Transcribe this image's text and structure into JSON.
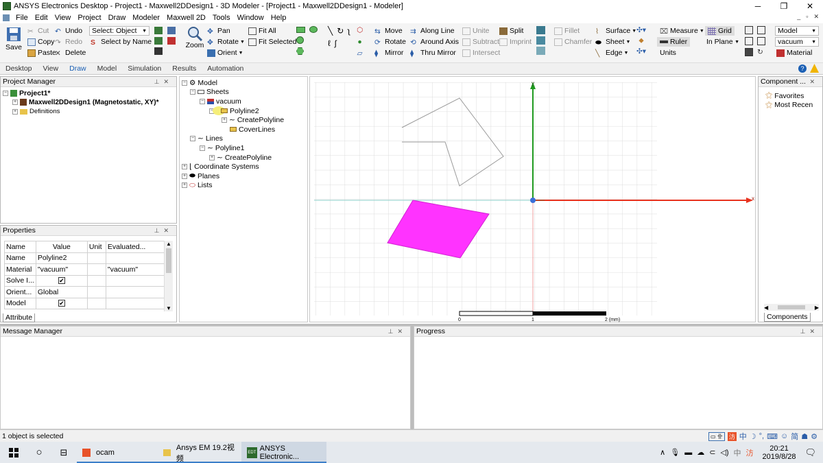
{
  "window": {
    "title": "ANSYS Electronics Desktop - Project1 - Maxwell2DDesign1 - 3D Modeler - [Project1 - Maxwell2DDesign1 - Modeler]",
    "minimize": "─",
    "maximize": "❐",
    "close": "✕"
  },
  "menu": [
    "File",
    "Edit",
    "View",
    "Project",
    "Draw",
    "Modeler",
    "Maxwell 2D",
    "Tools",
    "Window",
    "Help"
  ],
  "ribbon": {
    "save": "Save",
    "cut": "Cut",
    "copy": "Copy",
    "paste": "Paste",
    "undo": "Undo",
    "redo": "Redo",
    "delete": "Delete",
    "select_value": "Select: Object",
    "select_by_name": "Select by Name",
    "zoom": "Zoom",
    "pan": "Pan",
    "rotate": "Rotate",
    "orient": "Orient",
    "fit_all": "Fit All",
    "fit_selected": "Fit Selected",
    "move": "Move",
    "rotate2": "Rotate",
    "mirror": "Mirror",
    "along_line": "Along Line",
    "around_axis": "Around Axis",
    "thru_mirror": "Thru Mirror",
    "unite": "Unite",
    "subtract": "Subtract",
    "intersect": "Intersect",
    "split": "Split",
    "imprint": "Imprint",
    "fillet": "Fillet",
    "chamfer": "Chamfer",
    "surface": "Surface",
    "sheet": "Sheet",
    "edge": "Edge",
    "measure": "Measure",
    "ruler": "Ruler",
    "units": "Units",
    "grid": "Grid",
    "in_plane": "In Plane",
    "model_sel": "Model",
    "vacuum_sel": "vacuum",
    "material": "Material"
  },
  "tabs": [
    "Desktop",
    "View",
    "Draw",
    "Model",
    "Simulation",
    "Results",
    "Automation"
  ],
  "active_tab": "Draw",
  "project_manager": {
    "title": "Project Manager",
    "project": "Project1*",
    "design": "Maxwell2DDesign1 (Magnetostatic, XY)*",
    "definitions": "Definitions"
  },
  "model_tree": {
    "model": "Model",
    "sheets": "Sheets",
    "vacuum": "vacuum",
    "polyline2": "Polyline2",
    "create_polyline": "CreatePolyline",
    "cover_lines": "CoverLines",
    "lines": "Lines",
    "polyline1": "Polyline1",
    "create_polyline2": "CreatePolyline",
    "coordinate_systems": "Coordinate Systems",
    "planes": "Planes",
    "lists": "Lists"
  },
  "properties": {
    "title": "Properties",
    "headers": [
      "Name",
      "Value",
      "Unit",
      "Evaluated..."
    ],
    "rows": [
      {
        "name": "Name",
        "value": "Polyline2",
        "unit": "",
        "evaluated": ""
      },
      {
        "name": "Material",
        "value": "\"vacuum\"",
        "unit": "",
        "evaluated": "\"vacuum\""
      },
      {
        "name": "Solve I...",
        "value": "checked",
        "unit": "",
        "evaluated": ""
      },
      {
        "name": "Orient...",
        "value": "Global",
        "unit": "",
        "evaluated": ""
      },
      {
        "name": "Model",
        "value": "checked",
        "unit": "",
        "evaluated": ""
      }
    ],
    "tab": "Attribute"
  },
  "component_panel": {
    "title": "Component ...",
    "items": [
      "Favorites",
      "Most Recen"
    ],
    "tab": "Components"
  },
  "viewport": {
    "axis_x": "x",
    "axis_y": "y",
    "scale_labels": [
      "0",
      "1",
      "2 (mm)"
    ],
    "colors": {
      "x_axis": "#e8321e",
      "y_axis": "#1f9a1f",
      "filled_sheet": "#ff33ff",
      "grid": "#dcdcdc"
    }
  },
  "message_manager": {
    "title": "Message Manager"
  },
  "progress": {
    "title": "Progress"
  },
  "status": "1 object is selected",
  "taskbar": {
    "items": [
      "ocam",
      "Ansys EM 19.2视频",
      "ANSYS Electronic..."
    ],
    "time": "20:21",
    "date": "2019/8/28",
    "ime": "中"
  }
}
